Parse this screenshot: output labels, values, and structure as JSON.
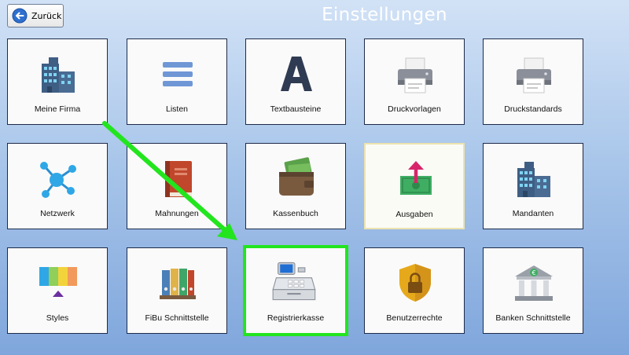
{
  "header": {
    "back_label": "Zurück",
    "title": "Einstellungen"
  },
  "tiles": [
    {
      "label": "Meine Firma",
      "icon": "building-icon"
    },
    {
      "label": "Listen",
      "icon": "list-icon"
    },
    {
      "label": "Textbausteine",
      "icon": "letter-a-icon"
    },
    {
      "label": "Druckvorlagen",
      "icon": "printer-icon"
    },
    {
      "label": "Druckstandards",
      "icon": "printer-icon"
    },
    {
      "label": "Netzwerk",
      "icon": "network-icon"
    },
    {
      "label": "Mahnungen",
      "icon": "book-icon"
    },
    {
      "label": "Kassenbuch",
      "icon": "wallet-icon"
    },
    {
      "label": "Ausgaben",
      "icon": "money-out-icon"
    },
    {
      "label": "Mandanten",
      "icon": "building-icon"
    },
    {
      "label": "Styles",
      "icon": "color-palette-icon"
    },
    {
      "label": "FiBu Schnittstelle",
      "icon": "binders-icon"
    },
    {
      "label": "Registrierkasse",
      "icon": "cash-register-icon"
    },
    {
      "label": "Benutzerrechte",
      "icon": "shield-lock-icon"
    },
    {
      "label": "Banken Schnittstelle",
      "icon": "bank-icon"
    }
  ],
  "colors": {
    "highlight_border": "#22e51e",
    "arrow": "#22e51e",
    "title": "#ffffff"
  }
}
